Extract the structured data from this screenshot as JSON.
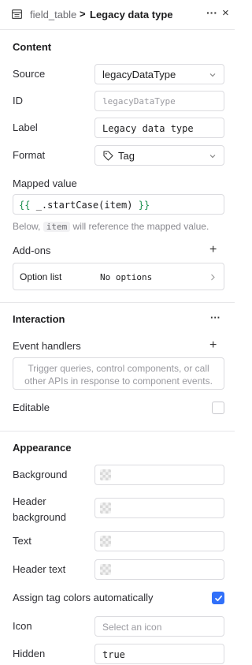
{
  "header": {
    "parent": "field_table",
    "separator": ">",
    "current": "Legacy data type",
    "more": "···",
    "close": "×"
  },
  "content": {
    "title": "Content",
    "source": {
      "label": "Source",
      "value": "legacyDataType"
    },
    "id": {
      "label": "ID",
      "placeholder": "legacyDataType"
    },
    "labelField": {
      "label": "Label",
      "value": "Legacy data type"
    },
    "format": {
      "label": "Format",
      "value": "Tag"
    },
    "mapped": {
      "label": "Mapped value",
      "open": "{{",
      "code": "_.startCase(item)",
      "close": "}}",
      "help_before": "Below,",
      "help_code": "item",
      "help_after": "will reference the mapped value."
    },
    "addons": {
      "label": "Add-ons",
      "plus": "+",
      "option_list_label": "Option list",
      "option_list_value": "No options"
    }
  },
  "interaction": {
    "title": "Interaction",
    "more": "···",
    "event_handlers_label": "Event handlers",
    "plus": "+",
    "event_placeholder_line1": "Trigger queries, control components, or call",
    "event_placeholder_line2": "other APIs in response to component events.",
    "editable_label": "Editable",
    "editable": false
  },
  "appearance": {
    "title": "Appearance",
    "background_label": "Background",
    "header_bg_line1": "Header",
    "header_bg_line2": "background",
    "text_label": "Text",
    "header_text_label": "Header text",
    "assign_colors_label": "Assign tag colors automatically",
    "assign_colors": true,
    "icon_label": "Icon",
    "icon_placeholder": "Select an icon",
    "hidden_label": "Hidden",
    "hidden_value": "true"
  },
  "colors": {
    "accent": "#3170f9",
    "code_green": "#1a8f4c",
    "border": "#dcdce0"
  }
}
